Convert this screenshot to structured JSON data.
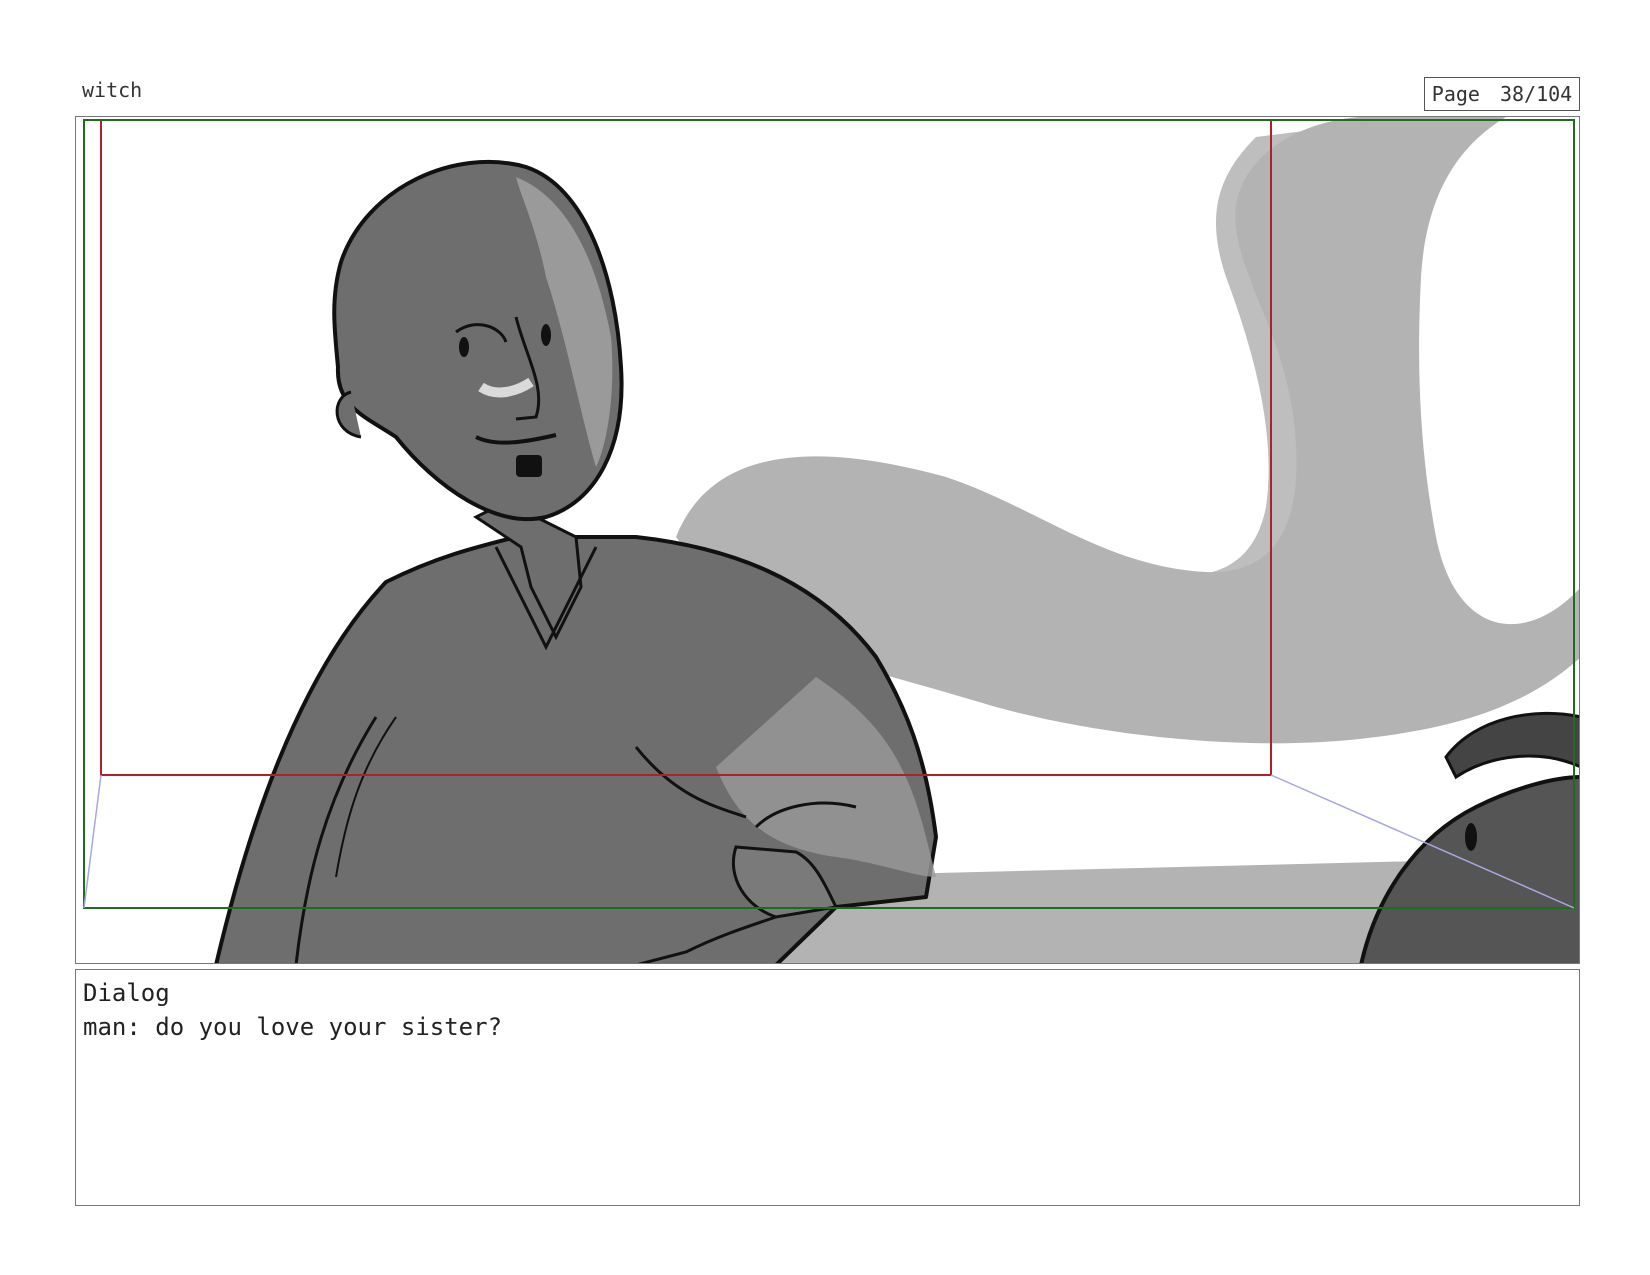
{
  "header": {
    "project_name": "witch",
    "page_label": "Page",
    "page_number": "38/104"
  },
  "panel": {
    "frame_colors": {
      "safe_area": "#b0202a",
      "action_area": "#1f6b1f",
      "camera_move": "#a8a8e0"
    },
    "shading_colors": {
      "character": "#6e6e6e",
      "smoke": "#b3b3b3",
      "outline": "#111111"
    }
  },
  "dialog": {
    "heading": "Dialog",
    "line": "man: do you love your sister?"
  }
}
